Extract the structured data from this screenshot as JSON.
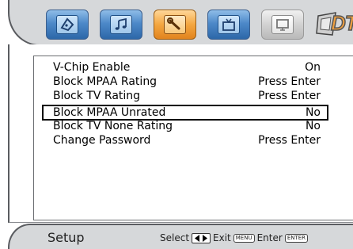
{
  "tabs": [
    {
      "name": "Picture",
      "icon": "picture-icon"
    },
    {
      "name": "Sound",
      "icon": "music-note-icon"
    },
    {
      "name": "Setup",
      "icon": "wrench-icon"
    },
    {
      "name": "TV",
      "icon": "tv-icon"
    },
    {
      "name": "PC",
      "icon": "monitor-icon"
    }
  ],
  "logo": {
    "text": "DTV"
  },
  "menu": {
    "items": [
      {
        "label": "V-Chip Enable",
        "value": "On"
      },
      {
        "label": "Block MPAA Rating",
        "value": "Press Enter"
      },
      {
        "label": "Block TV Rating",
        "value": "Press Enter"
      },
      {
        "label": "Block MPAA Unrated",
        "value": "No"
      },
      {
        "label": "Block TV None Rating",
        "value": "No"
      },
      {
        "label": "Change Password",
        "value": "Press Enter"
      }
    ]
  },
  "footer": {
    "title": "Setup",
    "select_label": "Select",
    "exit_label": "Exit",
    "menu_key": "MENU",
    "enter_label": "Enter",
    "enter_key": "ENTER"
  },
  "colors": {
    "active_tab": "#f4a640",
    "tab": "#4d89c9",
    "disabled_tab": "#d2d2d2",
    "shell": "#d6d8da"
  }
}
